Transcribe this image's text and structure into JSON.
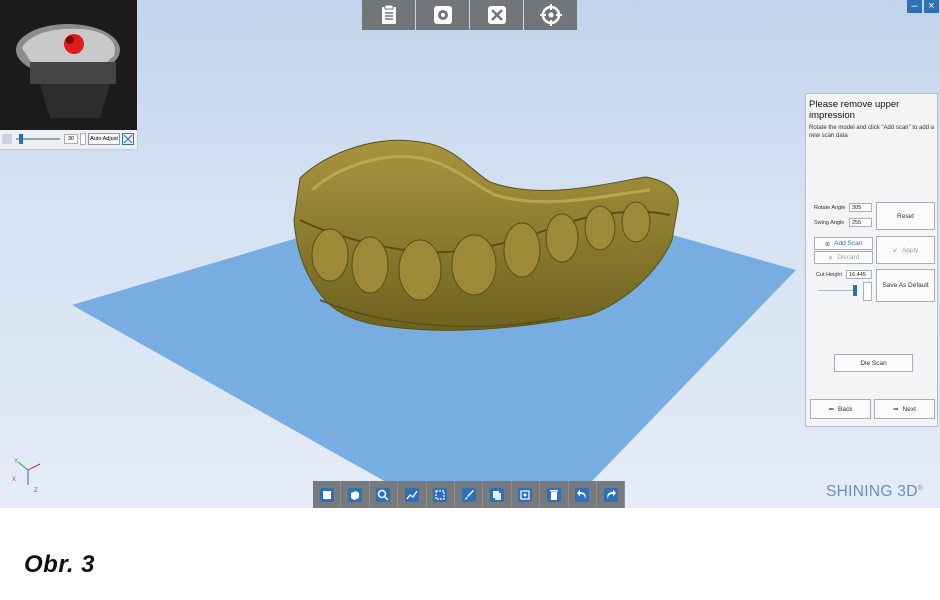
{
  "app": {
    "brand": "SHINING 3D",
    "brand_mark": "®"
  },
  "window": {
    "minimize_glyph": "–",
    "close_glyph": "×"
  },
  "toolbar_top": [
    "report-icon",
    "settings-icon",
    "tools-icon",
    "target-icon"
  ],
  "camera_preview": {
    "value": "30",
    "auto_adjust_label": "Auto Adjust"
  },
  "panel": {
    "title": "Please remove upper impression",
    "description": "Rotate the model and click \"Add scan\" to add a new scan data",
    "rotate_angle_label": "Rotate Angle",
    "rotate_angle_value": "305",
    "swing_angle_label": "Swing Angle",
    "swing_angle_value": "255",
    "reset_label": "Reset",
    "add_scan_label": "Add Scan",
    "discard_label": "Discard",
    "apply_label": "Apply",
    "cut_height_label": "Cut Height",
    "cut_height_value": "16.445",
    "save_default_label": "Save As Default",
    "die_scan_label": "Die Scan",
    "back_label": "Back",
    "next_label": "Next"
  },
  "toolbar_bottom": [
    "front-view-icon",
    "side-view-icon",
    "zoom-icon",
    "chart-icon",
    "select-rect-icon",
    "brush-icon",
    "copy-icon",
    "fit-icon",
    "delete-icon",
    "undo-icon",
    "redo-icon"
  ],
  "axes": {
    "y": "Y",
    "x": "X",
    "z": "Z"
  },
  "caption": "Obr. 3",
  "colors": {
    "accent": "#2f6fb8",
    "plane": "#6aa6dd",
    "model": "#8a7a2e",
    "toolbar": "#777a7d"
  }
}
